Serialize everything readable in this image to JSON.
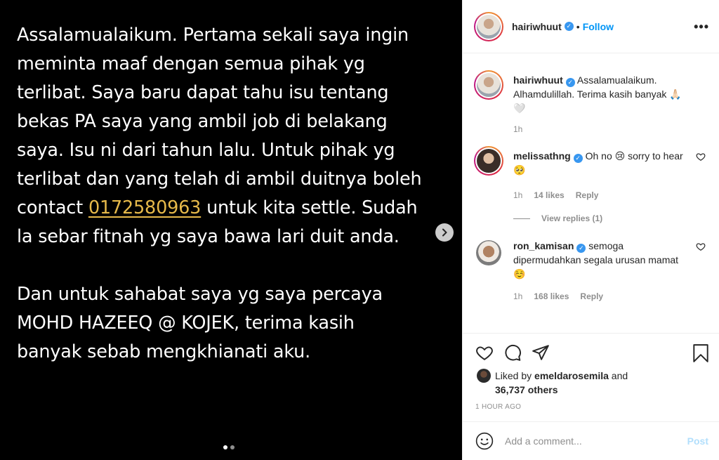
{
  "post_image": {
    "lines": [
      "Assalamualaikum. Pertama sekali saya ingin",
      "meminta maaf dengan semua pihak yg",
      "terlibat. Saya baru dapat tahu isu tentang",
      "bekas PA saya yang ambil job di belakang",
      "saya. Isu ni dari tahun lalu. Untuk pihak yg",
      "terlibat dan yang telah di ambil duitnya boleh"
    ],
    "contact_prefix": "contact ",
    "phone": "0172580963",
    "contact_suffix": " untuk kita settle. Sudah",
    "line8": "la sebar fitnah yg saya bawa lari duit anda.",
    "para2": [
      "Dan untuk sahabat saya yg saya percaya",
      "MOHD HAZEEQ @ KOJEK, terima kasih",
      "banyak sebab mengkhianati aku."
    ],
    "slide_count": 2,
    "active_slide": 1
  },
  "header": {
    "username": "hairiwhuut",
    "separator": "•",
    "follow_label": "Follow",
    "more_icon": "more-horizontal-icon"
  },
  "caption": {
    "username": "hairiwhuut",
    "text": "Assalamualaikum. Alhamdulillah. Terima kasih banyak 🙏🏻🤍",
    "time": "1h"
  },
  "comments": [
    {
      "username": "melissathng",
      "text": "Oh no 😢 sorry to hear 🥺",
      "time": "1h",
      "likes": "14 likes",
      "reply": "Reply",
      "view_replies": "View replies (1)"
    },
    {
      "username": "ron_kamisan",
      "text": "semoga dipermudahkan segala urusan mamat ☺️",
      "time": "1h",
      "likes": "168 likes",
      "reply": "Reply"
    }
  ],
  "actions": {
    "liked_prefix": "Liked by ",
    "liked_user": "emeldarosemila",
    "liked_and": " and",
    "others": "36,737 others",
    "timestamp": "1 HOUR AGO"
  },
  "add_comment": {
    "placeholder": "Add a comment...",
    "post_label": "Post"
  },
  "colors": {
    "accent": "#0095f6",
    "phone_highlight": "#e6b94a",
    "verified": "#3897f0"
  }
}
